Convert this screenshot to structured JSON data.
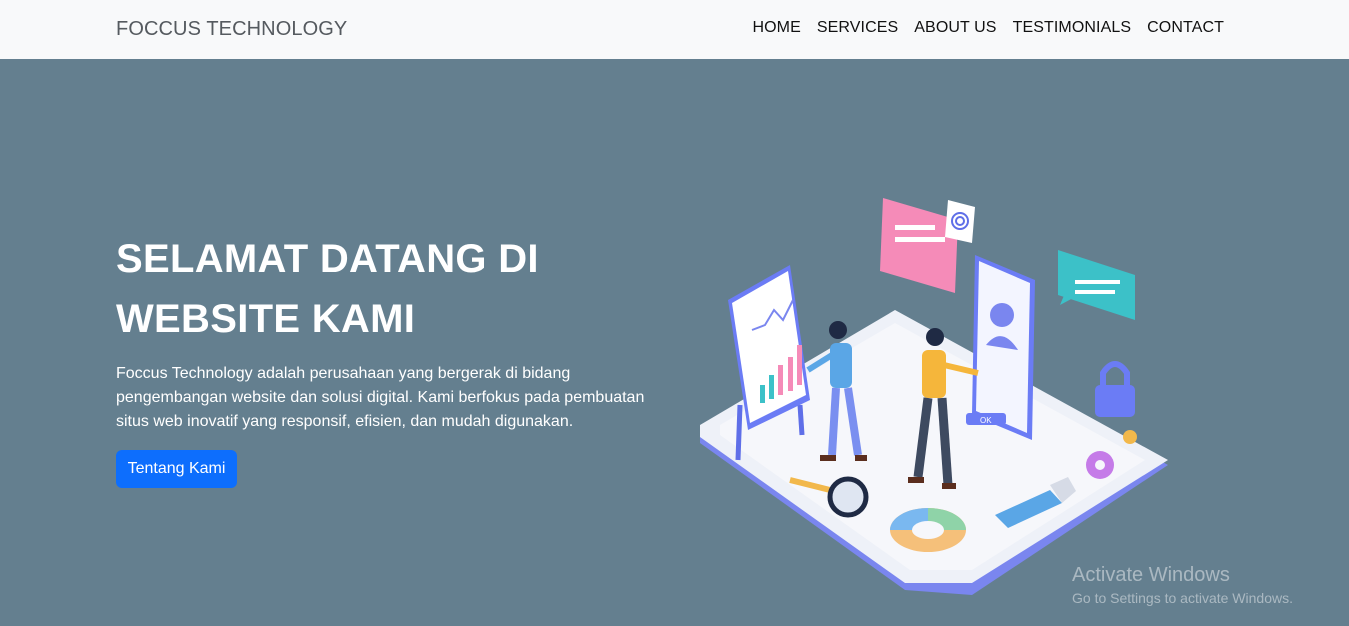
{
  "navbar": {
    "brand": "FOCCUS TECHNOLOGY",
    "links": [
      "HOME",
      "SERVICES",
      "ABOUT US",
      "TESTIMONIALS",
      "CONTACT"
    ]
  },
  "hero": {
    "title": "SELAMAT DATANG DI WEBSITE KAMI",
    "description": "Foccus Technology adalah perusahaan yang bergerak di bidang pengembangan website dan solusi digital. Kami berfokus pada pembuatan situs web inovatif yang responsif, efisien, dan mudah digunakan.",
    "button_label": "Tentang Kami",
    "illustration_button_label": "OK"
  },
  "watermark": {
    "title": "Activate Windows",
    "subtitle": "Go to Settings to activate Windows."
  },
  "colors": {
    "hero_bg": "#647f8f",
    "navbar_bg": "#f8f9fa",
    "button_bg": "#0d6efd",
    "illustration_accent": "#6b7cf5"
  }
}
